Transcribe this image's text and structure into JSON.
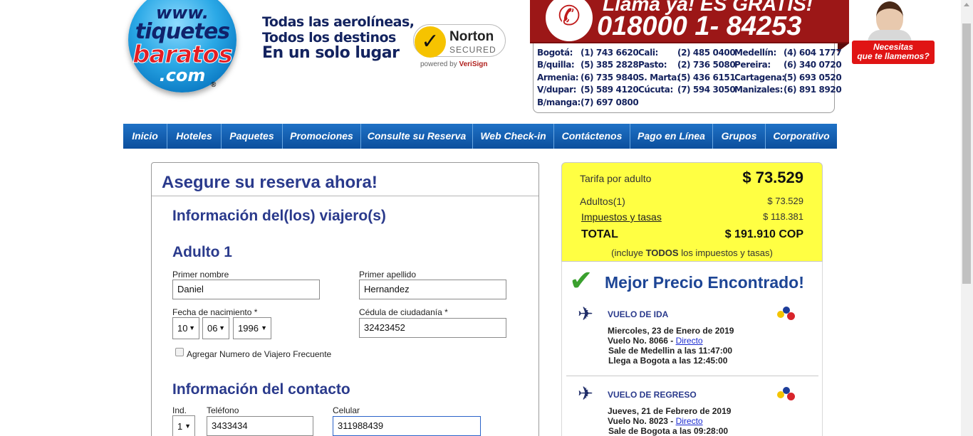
{
  "header": {
    "logo": {
      "www": "www.",
      "tiquetes": "tiquetes",
      "baratos": "baratos",
      "com": ".com",
      "registered": "®"
    },
    "slogan": [
      "Todas las aerolíneas,",
      "Todos los destinos",
      "En un solo lugar"
    ],
    "norton": {
      "name": "Norton",
      "secured": "SECURED",
      "powered_by": "powered by",
      "verisign": "VeriSign"
    },
    "phone": {
      "headline": "Llama ya! ES GRATIS!",
      "number": "018000 1- 84253",
      "icon": "phone-icon"
    },
    "cities": [
      [
        "Bogotá:",
        "(1) 743 6620",
        "Cali:",
        "(2) 485 0400",
        "Medellín:",
        "(4) 604 1777"
      ],
      [
        "B/quilla:",
        "(5) 385 2828",
        "Pasto:",
        "(2) 736 5080",
        "Pereira:",
        "(6) 340 0720"
      ],
      [
        "Armenia:",
        "(6) 735 9840",
        "S. Marta:",
        "(5) 436 6151",
        "Cartagena:",
        "(5) 693 0520"
      ],
      [
        "V/dupar:",
        "(5) 589 4120",
        "Cúcuta:",
        "(7) 594 3050",
        "Manizales:",
        "(6) 891 8920"
      ],
      [
        "B/manga:",
        "(7) 697 0800",
        "",
        "",
        "",
        ""
      ]
    ],
    "callback": {
      "line1": "Necesitas",
      "line2": "que te llamemos?"
    }
  },
  "nav": [
    "Inicio",
    "Hoteles",
    "Paquetes",
    "Promociones",
    "Consulte su Reserva",
    "Web Check-in",
    "Contáctenos",
    "Pago en Línea",
    "Grupos",
    "Corporativo"
  ],
  "form": {
    "title": "Asegure su reserva ahora!",
    "travelers_heading": "Información del(los) viajero(s)",
    "adult_heading": "Adulto 1",
    "first_name_label": "Primer nombre",
    "first_name_value": "Daniel",
    "last_name_label": "Primer apellido",
    "last_name_value": "Hernandez",
    "birth_label": "Fecha de nacimiento *",
    "birth_day": "10",
    "birth_month": "06",
    "birth_year": "1996",
    "id_label": "Cédula de ciudadanía *",
    "id_value": "32423452",
    "frequent_flyer_label": "Agregar Numero de Viajero Frecuente",
    "contact_heading": "Información del contacto",
    "ind_label": "Ind.",
    "ind_value": "1",
    "phone_label": "Teléfono",
    "phone_value": "3433434",
    "cell_label": "Celular",
    "cell_value": "311988439"
  },
  "summary": {
    "fare_label": "Tarifa por adulto",
    "fare_value": "$ 73.529",
    "adults_label": "Adultos(1)",
    "adults_value": "$ 73.529",
    "taxes_label": "Impuestos y tasas",
    "taxes_value": "$ 118.381",
    "total_label": "TOTAL",
    "total_value": "$ 191.910 COP",
    "note_pre": "(incluye ",
    "note_bold": "TODOS",
    "note_post": " los impuestos y tasas)",
    "colors": {
      "background": "#ffff43"
    }
  },
  "flights": {
    "best_price": "Mejor Precio Encontrado!",
    "outbound": {
      "title": "VUELO DE IDA",
      "date": "Miercoles, 23 de Enero de 2019",
      "flight_prefix": "Vuelo No. 8066 - ",
      "flight_link": "Directo",
      "departs": "Sale de Medellin a las 11:47:00",
      "arrives": "Llega a Bogota a las 12:45:00"
    },
    "return": {
      "title": "VUELO DE REGRESO",
      "date": "Jueves, 21 de Febrero de 2019",
      "flight_prefix": "Vuelo No. 8023 - ",
      "flight_link": "Directo",
      "departs": "Sale de Bogota a las 09:28:00"
    }
  }
}
